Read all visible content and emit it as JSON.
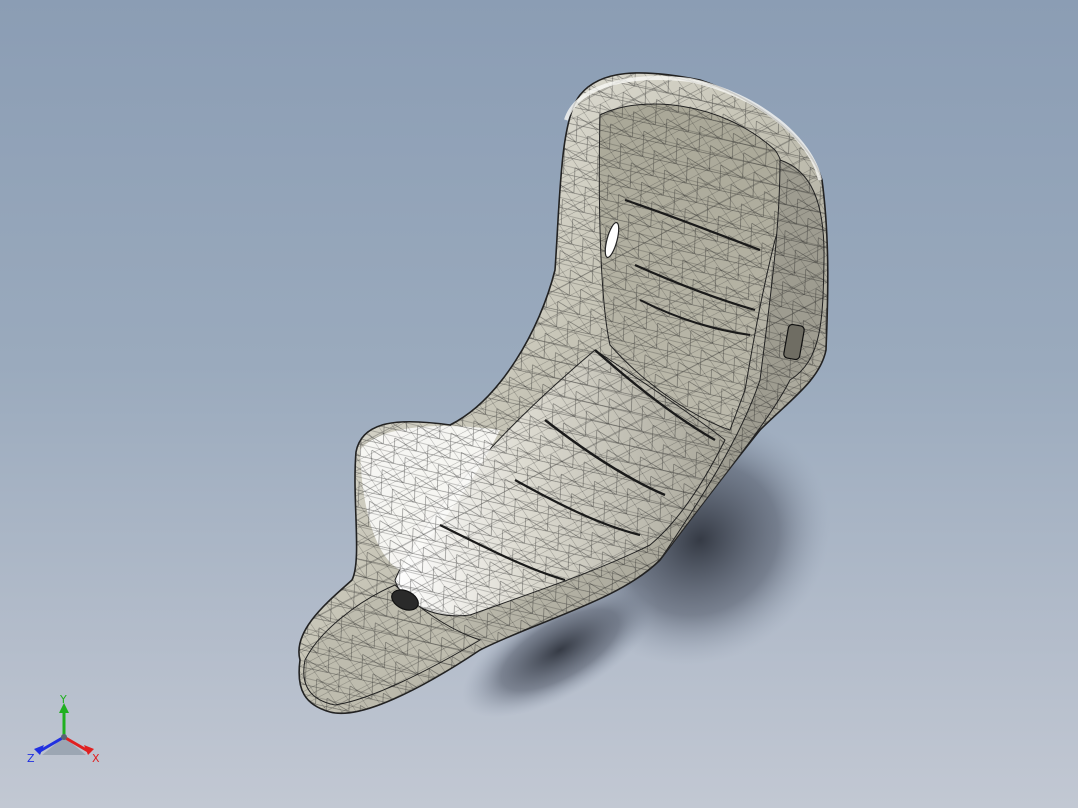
{
  "viewport": {
    "background_top": "#8b9db4",
    "background_bottom": "#c2c8d3"
  },
  "model": {
    "shell_color": "#c9c6b8",
    "shadow_color": "#3a3f4a",
    "mesh_color": "#1a1a1a",
    "display_mode": "shaded-with-edges"
  },
  "triad": {
    "x_label": "X",
    "y_label": "Y",
    "z_label": "Z",
    "x_color": "#e02020",
    "y_color": "#20b020",
    "z_color": "#2030e0"
  }
}
